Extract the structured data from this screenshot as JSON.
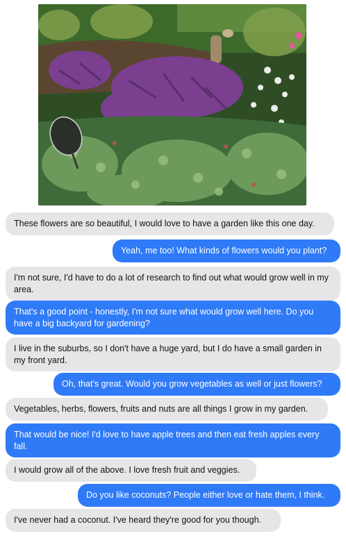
{
  "conversation": {
    "messages": [
      {
        "from": "them",
        "text": "These flowers are so beautiful, I would love to have a garden like this one day."
      },
      {
        "from": "me",
        "text": "Yeah, me too! What kinds of flowers would you plant?"
      },
      {
        "from": "them",
        "text": "I'm not sure, I'd have to do a lot of research to find out what would grow well in my area."
      },
      {
        "from": "me",
        "text": "That's a good point - honestly, I'm not sure what would grow well here. Do you have a big backyard for gardening?"
      },
      {
        "from": "them",
        "text": "I live in the suburbs, so I don't have a huge yard, but I do have a small garden in my front yard."
      },
      {
        "from": "me",
        "text": "Oh, that's great. Would you grow vegetables as well or just flowers?"
      },
      {
        "from": "them",
        "text": "Vegetables, herbs, flowers, fruits and nuts are all things I grow in my garden."
      },
      {
        "from": "me",
        "text": "That would be nice! I'd love to have apple trees and then eat fresh apples every fall."
      },
      {
        "from": "them",
        "text": "I would grow all of the above. I love fresh fruit and veggies."
      },
      {
        "from": "me",
        "text": "Do you like coconuts? People either love or hate them, I think."
      },
      {
        "from": "them",
        "text": "I've never had a coconut. I've heard they're good for you though."
      }
    ]
  },
  "colors": {
    "incoming_bubble": "#e6e6e8",
    "outgoing_bubble": "#2f7af7",
    "outgoing_text": "#ffffff"
  }
}
